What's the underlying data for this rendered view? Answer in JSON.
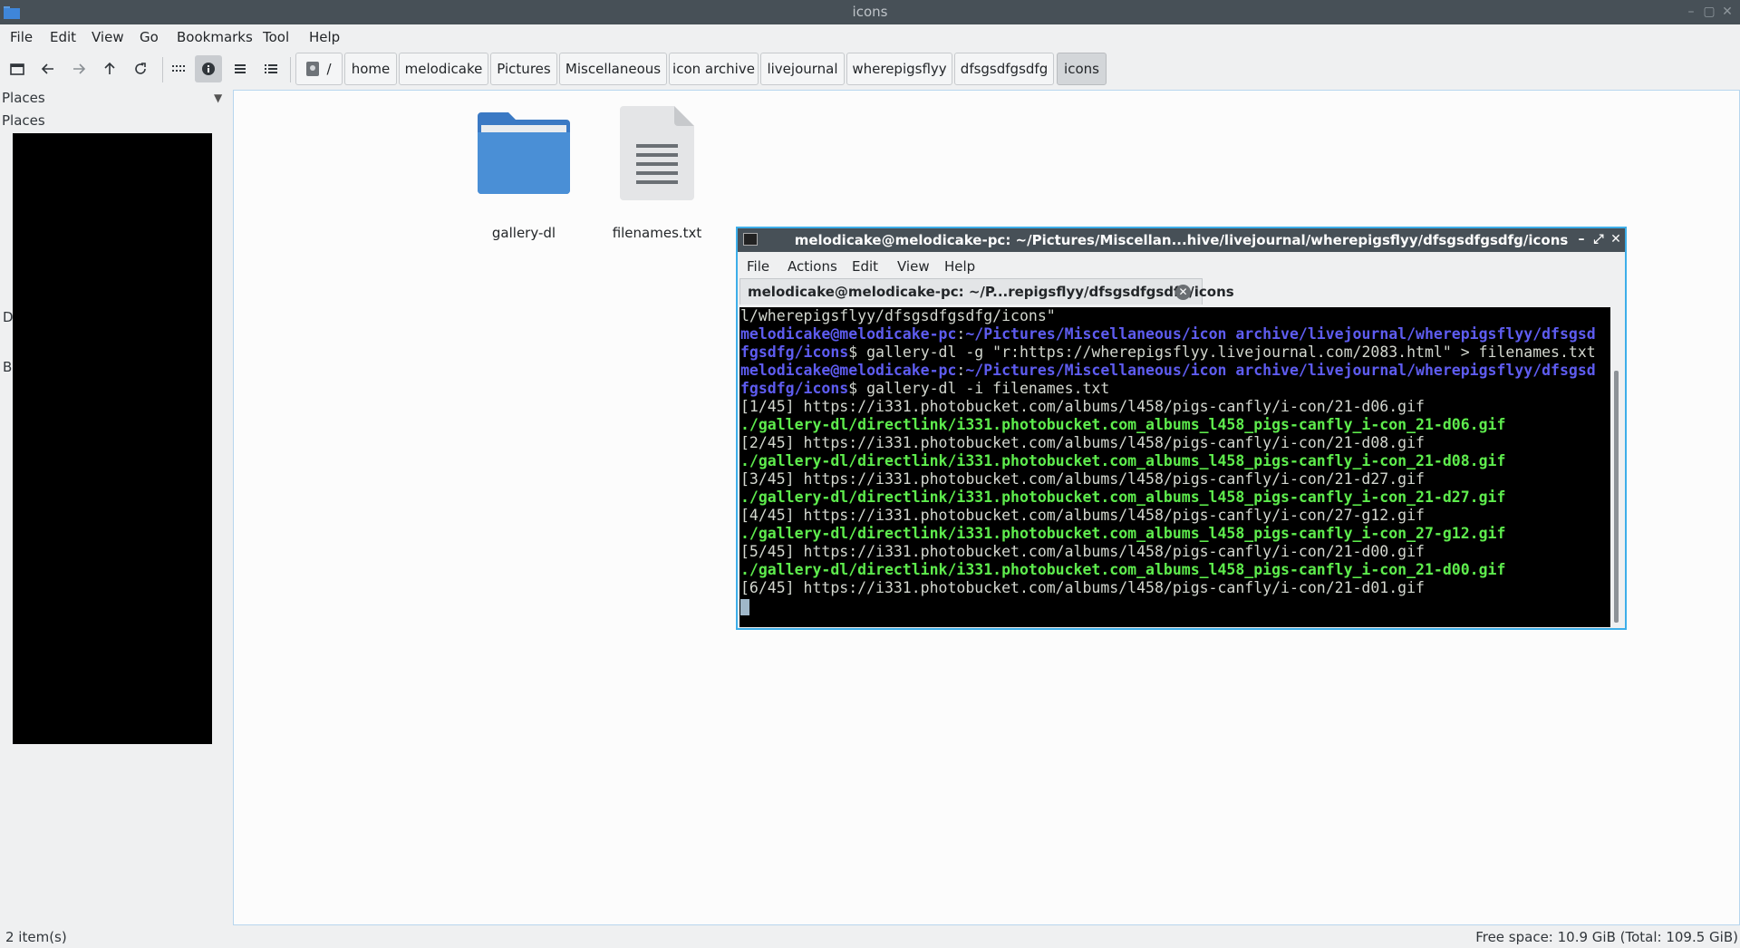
{
  "window": {
    "title": "icons"
  },
  "menubar": {
    "items": [
      "File",
      "Edit",
      "View",
      "Go",
      "Bookmarks",
      "Tool",
      "Help"
    ]
  },
  "breadcrumb": {
    "root": "/",
    "items": [
      "home",
      "melodicake",
      "Pictures",
      "Miscellaneous",
      "icon archive",
      "livejournal",
      "wherepigsflyy",
      "dfsgsdfgsdfg",
      "icons"
    ],
    "current": "icons"
  },
  "sidepane": {
    "title": "Places",
    "places_label": "Places",
    "stray_d": "D",
    "stray_b": "B"
  },
  "files": [
    {
      "name": "gallery-dl",
      "type": "folder"
    },
    {
      "name": "filenames.txt",
      "type": "text-file"
    }
  ],
  "status": {
    "items": "2 item(s)",
    "free_space": "Free space: 10.9 GiB (Total: 109.5 GiB)"
  },
  "terminal": {
    "title": "melodicake@melodicake-pc: ~/Pictures/Miscellan...hive/livejournal/wherepigsflyy/dfsgsdfgsdfg/icons",
    "menu": [
      "File",
      "Actions",
      "Edit",
      "View",
      "Help"
    ],
    "tab_label": "melodicake@melodicake-pc: ~/P...repigsflyy/dfsgsdfgsdfg/icons",
    "lines": [
      {
        "parts": [
          {
            "cls": "c-plain",
            "text": "l/wherepigsflyy/dfsgsdfgsdfg/icons\""
          }
        ]
      },
      {
        "parts": [
          {
            "cls": "c-user",
            "text": "melodicake@melodicake-pc"
          },
          {
            "cls": "c-plain",
            "text": ":"
          },
          {
            "cls": "c-path",
            "text": "~/Pictures/Miscellaneous/icon archive/livejournal/wherepigsflyy/dfsgsd"
          }
        ]
      },
      {
        "parts": [
          {
            "cls": "c-path",
            "text": "fgsdfg/icons"
          },
          {
            "cls": "c-plain",
            "text": "$ gallery-dl -g \"r:https://wherepigsflyy.livejournal.com/2083.html\" > filenames.txt"
          }
        ]
      },
      {
        "parts": [
          {
            "cls": "c-user",
            "text": "melodicake@melodicake-pc"
          },
          {
            "cls": "c-plain",
            "text": ":"
          },
          {
            "cls": "c-path",
            "text": "~/Pictures/Miscellaneous/icon archive/livejournal/wherepigsflyy/dfsgsd"
          }
        ]
      },
      {
        "parts": [
          {
            "cls": "c-path",
            "text": "fgsdfg/icons"
          },
          {
            "cls": "c-plain",
            "text": "$ gallery-dl -i filenames.txt"
          }
        ]
      },
      {
        "parts": [
          {
            "cls": "c-plain",
            "text": "[1/45] https://i331.photobucket.com/albums/l458/pigs-canfly/i-con/21-d06.gif"
          }
        ]
      },
      {
        "parts": [
          {
            "cls": "c-ok",
            "text": "./gallery-dl/directlink/i331.photobucket.com_albums_l458_pigs-canfly_i-con_21-d06.gif"
          }
        ]
      },
      {
        "parts": [
          {
            "cls": "c-plain",
            "text": "[2/45] https://i331.photobucket.com/albums/l458/pigs-canfly/i-con/21-d08.gif"
          }
        ]
      },
      {
        "parts": [
          {
            "cls": "c-ok",
            "text": "./gallery-dl/directlink/i331.photobucket.com_albums_l458_pigs-canfly_i-con_21-d08.gif"
          }
        ]
      },
      {
        "parts": [
          {
            "cls": "c-plain",
            "text": "[3/45] https://i331.photobucket.com/albums/l458/pigs-canfly/i-con/21-d27.gif"
          }
        ]
      },
      {
        "parts": [
          {
            "cls": "c-ok",
            "text": "./gallery-dl/directlink/i331.photobucket.com_albums_l458_pigs-canfly_i-con_21-d27.gif"
          }
        ]
      },
      {
        "parts": [
          {
            "cls": "c-plain",
            "text": "[4/45] https://i331.photobucket.com/albums/l458/pigs-canfly/i-con/27-g12.gif"
          }
        ]
      },
      {
        "parts": [
          {
            "cls": "c-ok",
            "text": "./gallery-dl/directlink/i331.photobucket.com_albums_l458_pigs-canfly_i-con_27-g12.gif"
          }
        ]
      },
      {
        "parts": [
          {
            "cls": "c-plain",
            "text": "[5/45] https://i331.photobucket.com/albums/l458/pigs-canfly/i-con/21-d00.gif"
          }
        ]
      },
      {
        "parts": [
          {
            "cls": "c-ok",
            "text": "./gallery-dl/directlink/i331.photobucket.com_albums_l458_pigs-canfly_i-con_21-d00.gif"
          }
        ]
      },
      {
        "parts": [
          {
            "cls": "c-plain",
            "text": "[6/45] https://i331.photobucket.com/albums/l458/pigs-canfly/i-con/21-d01.gif"
          }
        ]
      }
    ]
  },
  "colors": {
    "accent": "#3daee9",
    "folder": "#4a8fd6",
    "prompt": "#5e5cf0",
    "success": "#5eec4d"
  }
}
